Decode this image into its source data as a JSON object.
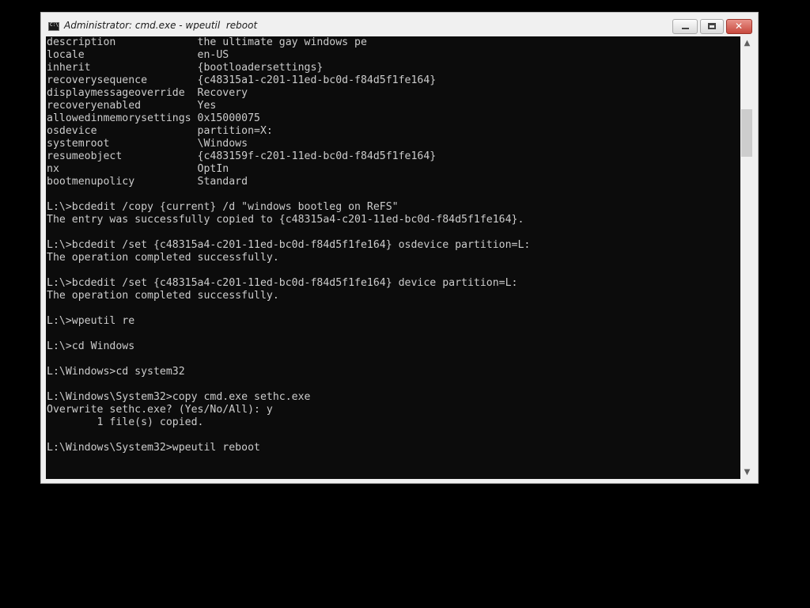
{
  "window": {
    "title": "Administrator: cmd.exe - wpeutil  reboot"
  },
  "icons": {
    "app": "cmd-icon",
    "minimize": "minimize-icon",
    "maximize": "maximize-icon",
    "close": "close-icon",
    "scroll_up": "scroll-up-arrow-icon",
    "scroll_down": "scroll-down-arrow-icon"
  },
  "colors": {
    "console_background": "#0c0c0c",
    "console_text": "#cccccc",
    "close_button": "#c7493e"
  },
  "console": {
    "lines": [
      "description             the ultimate gay windows pe",
      "locale                  en-US",
      "inherit                 {bootloadersettings}",
      "recoverysequence        {c48315a1-c201-11ed-bc0d-f84d5f1fe164}",
      "displaymessageoverride  Recovery",
      "recoveryenabled         Yes",
      "allowedinmemorysettings 0x15000075",
      "osdevice                partition=X:",
      "systemroot              \\Windows",
      "resumeobject            {c483159f-c201-11ed-bc0d-f84d5f1fe164}",
      "nx                      OptIn",
      "bootmenupolicy          Standard",
      "",
      "L:\\>bcdedit /copy {current} /d \"windows bootleg on ReFS\"",
      "The entry was successfully copied to {c48315a4-c201-11ed-bc0d-f84d5f1fe164}.",
      "",
      "L:\\>bcdedit /set {c48315a4-c201-11ed-bc0d-f84d5f1fe164} osdevice partition=L:",
      "The operation completed successfully.",
      "",
      "L:\\>bcdedit /set {c48315a4-c201-11ed-bc0d-f84d5f1fe164} device partition=L:",
      "The operation completed successfully.",
      "",
      "L:\\>wpeutil re",
      "",
      "L:\\>cd Windows",
      "",
      "L:\\Windows>cd system32",
      "",
      "L:\\Windows\\System32>copy cmd.exe sethc.exe",
      "Overwrite sethc.exe? (Yes/No/All): y",
      "        1 file(s) copied.",
      "",
      "L:\\Windows\\System32>wpeutil reboot"
    ]
  }
}
